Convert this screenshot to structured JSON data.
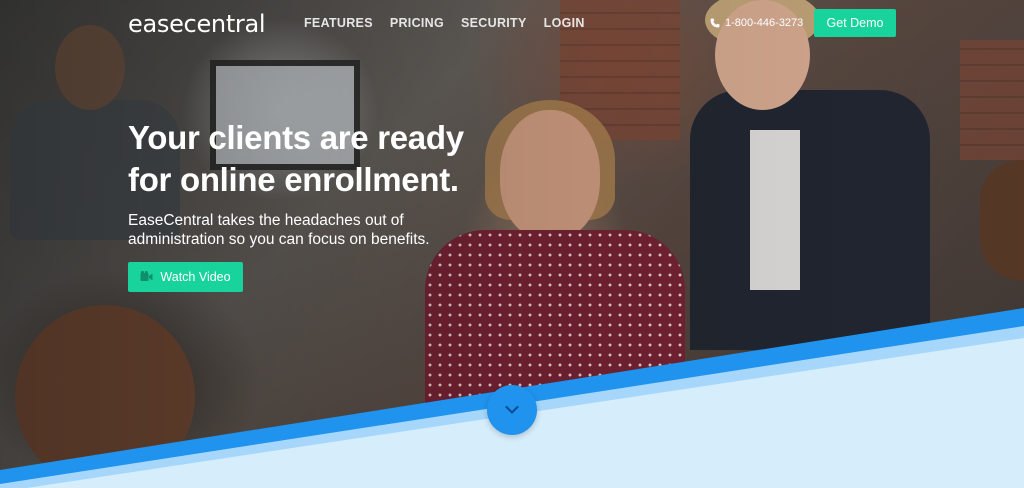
{
  "brand": {
    "logo_text": "easecentral"
  },
  "nav": {
    "items": [
      "FEATURES",
      "PRICING",
      "SECURITY",
      "LOGIN"
    ]
  },
  "header": {
    "phone": "1-800-446-3273",
    "demo_label": "Get Demo"
  },
  "hero": {
    "headline": "Your clients are ready for online enrollment.",
    "subtext": "EaseCentral takes the headaches out of administration so you can focus on benefits.",
    "watch_label": "Watch Video"
  },
  "colors": {
    "accent_green": "#19d39c",
    "band_blue": "#1f93ee",
    "band_light": "#d6edfc"
  },
  "icons": {
    "phone": "phone-icon",
    "video": "video-icon",
    "scroll": "chevron-down-icon"
  }
}
